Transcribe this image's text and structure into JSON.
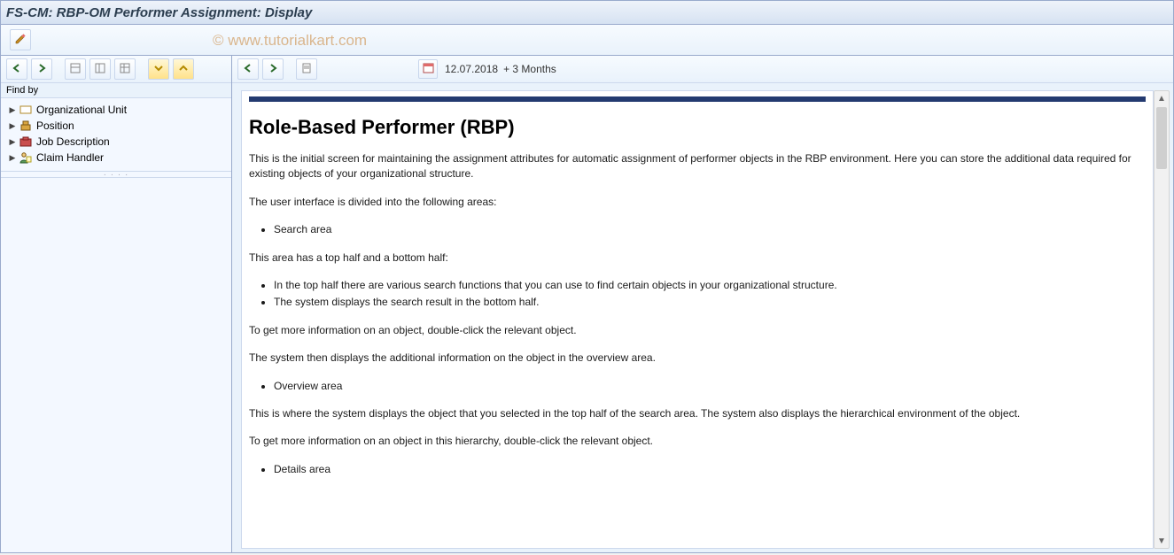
{
  "title": "FS-CM: RBP-OM Performer Assignment: Display",
  "watermark": "© www.tutorialkart.com",
  "left": {
    "find_by": "Find by",
    "tree": [
      {
        "icon": "org-unit-icon",
        "label": "Organizational Unit"
      },
      {
        "icon": "position-icon",
        "label": "Position"
      },
      {
        "icon": "job-icon",
        "label": "Job Description"
      },
      {
        "icon": "person-icon",
        "label": "Claim Handler"
      }
    ]
  },
  "right": {
    "date": "12.07.2018",
    "range": "+ 3 Months"
  },
  "doc": {
    "heading": "Role-Based Performer (RBP)",
    "p1": "This is the initial screen for maintaining the assignment attributes for automatic assignment of performer objects in the RBP environment. Here you can store the additional data required for existing objects of your organizational structure.",
    "p2": "The user interface is divided into the following areas:",
    "b1": "Search area",
    "p3": "This area has a top half and a bottom half:",
    "b2": "In the top half there are various search functions that you can use to find certain objects in your organizational structure.",
    "b3": "The system displays the search result in the bottom half.",
    "p4": "To get more information on an object, double-click the relevant object.",
    "p5": "The system then displays the additional information on the object in the overview area.",
    "b4": "Overview area",
    "p6": "This is where the system displays the object that you selected in the top half of the search area. The system also displays the hierarchical environment of the object.",
    "p7": "To get more information on an object in this hierarchy, double-click the relevant object.",
    "b5": "Details area"
  }
}
